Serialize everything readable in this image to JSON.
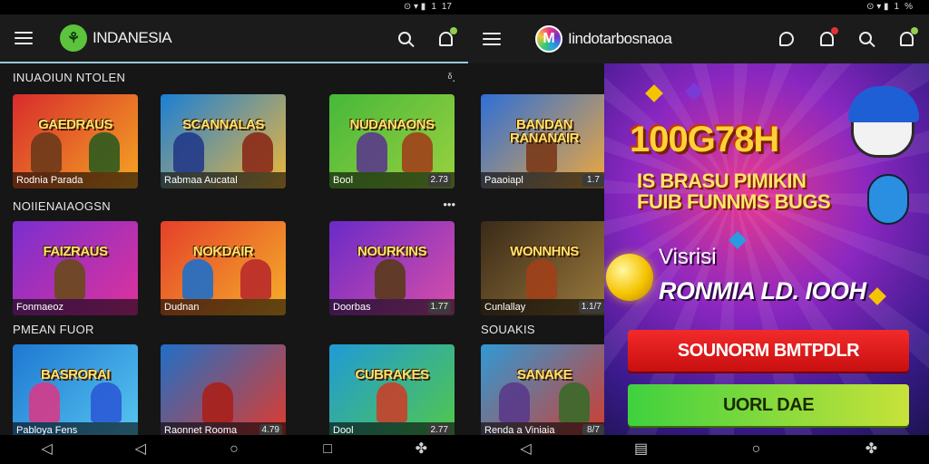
{
  "left": {
    "status": {
      "icons": "⊙ ▾ ▮",
      "signal": "1",
      "time": "17"
    },
    "appbar": {
      "brand_name": "INDANESIA"
    },
    "sections": [
      {
        "title": "INUAOIUN NTOLEN",
        "more": "ᵟ.",
        "cards": [
          {
            "title": "GAEDRAUS",
            "label": "Rodnia Parada",
            "badge": "",
            "colors": [
              "#d82c2c",
              "#f5a623"
            ]
          },
          {
            "title": "SCANNALAS",
            "label": "Rabmaa Aucatal",
            "badge": "",
            "colors": [
              "#1b7fd6",
              "#f0b73a"
            ]
          },
          {
            "title": "NUDANAONS",
            "label": "Bool",
            "badge": "2.73",
            "colors": [
              "#47b83a",
              "#9ad13f"
            ]
          }
        ]
      },
      {
        "title": "NOIIENAIAOGSN",
        "more": "•••",
        "cards": [
          {
            "title": "FAIZRAUS",
            "label": "Fonmaeoz",
            "badge": "",
            "colors": [
              "#7a2fd0",
              "#e0329a"
            ]
          },
          {
            "title": "NOKDAIR",
            "label": "Dudnan",
            "badge": "",
            "colors": [
              "#e5402a",
              "#f5b02a"
            ]
          },
          {
            "title": "NOURKINS",
            "label": "Doorbas",
            "badge": "1.77",
            "colors": [
              "#6a2ac8",
              "#d94fa8"
            ]
          }
        ]
      },
      {
        "title": "PMEAN FUOR",
        "more": "",
        "cards": [
          {
            "title": "BASRORAI",
            "label": "Pabloya Fens",
            "badge": "",
            "colors": [
              "#1e78d2",
              "#58c7f0"
            ]
          },
          {
            "title": "",
            "label": "Raonnet Rooma",
            "badge": "4.79",
            "colors": [
              "#1f6fc8",
              "#e23a2a"
            ]
          },
          {
            "title": "CUBRAKES",
            "label": "Dool",
            "badge": "2.77",
            "colors": [
              "#1f9ad6",
              "#53c84a"
            ]
          }
        ]
      }
    ],
    "nav": {
      "back": "◁",
      "back2": "◁",
      "home": "○",
      "recents": "□",
      "extra": "✤"
    }
  },
  "right": {
    "status": {
      "icons": "⊙ ▾ ▮",
      "signal": "1",
      "time": "%"
    },
    "appbar": {
      "brand_name": "Iindotarbosnaoa"
    },
    "side_cards": [
      {
        "title": "BANDAN RANANAIR",
        "label": "Paaoiapl",
        "badge": "1.7",
        "colors": [
          "#2e6fd8",
          "#f2a93a"
        ]
      },
      {
        "title": "WONNHNS",
        "label": "Cunlallay",
        "badge": "1.1/7",
        "colors": [
          "#3a2a18",
          "#9b7a3c"
        ]
      },
      {
        "title": "SANAKE",
        "label": "Renda a Viniaia",
        "badge": "8/7",
        "colors": [
          "#2f9ad6",
          "#d63a2a"
        ]
      }
    ],
    "side_section_title": "SOUAKIS",
    "promo": {
      "headline": "100G78H",
      "sub_line1": "IS BRASU PIMIKIN",
      "sub_line2": "FUIB FUNNMS BUGS",
      "text1": "Visrisi",
      "text2": "RONMIA LD. IOOH",
      "button_red": "SOUNORM BMTPDLR",
      "button_green": "UORL DAE"
    },
    "nav": {
      "back": "◁",
      "menu": "▤",
      "home": "○",
      "extra": "✤"
    }
  }
}
